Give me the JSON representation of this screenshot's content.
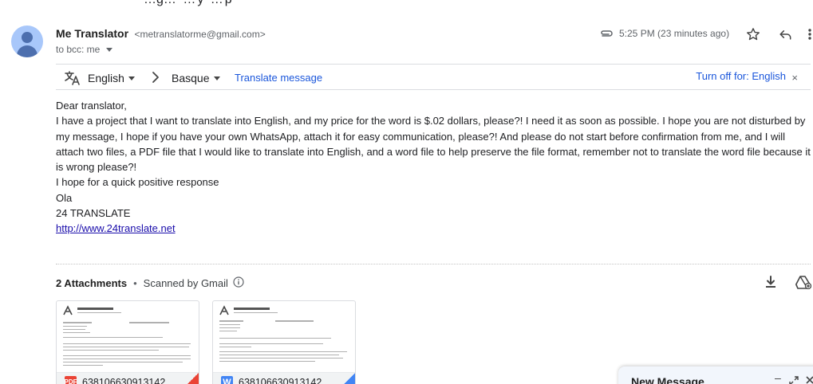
{
  "header_cut": {
    "text": "…g",
    "trail": "…  …y  …p"
  },
  "sender": {
    "name": "Me Translator",
    "email": "<metranslatorme@gmail.com>",
    "to": "to bcc: me"
  },
  "meta": {
    "time": "5:25 PM (23 minutes ago)"
  },
  "translate_bar": {
    "source_lang": "English",
    "target_lang": "Basque",
    "translate_label": "Translate message",
    "turn_off_label": "Turn off for: English",
    "close_label": "×"
  },
  "body": {
    "lines": [
      "Dear translator,",
      "I have a project that I want to translate into English, and my price for the word is $.02 dollars, please?! I need it as soon as possible. I hope you are not disturbed by my message, I hope if you have your own WhatsApp, attach it for easy communication, please?! And please do not start before confirmation from me, and I will attach two files, a PDF file that I would like to translate into English, and a word file to help preserve the file format, remember not to translate the word file because it is wrong please?!",
      "I hope for a quick positive response",
      "Ola",
      "24 TRANSLATE"
    ],
    "link": "http://www.24translate.net"
  },
  "attachments": {
    "title": "2 Attachments",
    "separator": "•",
    "scanned": "Scanned by Gmail",
    "items": [
      {
        "name": "638106630913142",
        "type_badge": "PDF",
        "type": "pdf"
      },
      {
        "name": "638106630913142",
        "type_badge": "W",
        "type": "word"
      }
    ]
  },
  "new_message": {
    "title": "New Message",
    "minimize": "–"
  },
  "icons": {
    "avatar": "person-icon",
    "attachment": "paperclip-icon",
    "star": "star-icon",
    "reply": "reply-icon",
    "more": "more-vert-icon",
    "translate": "translate-icon",
    "arrow": "chevron-right-icon",
    "info": "info-icon",
    "download": "download-icon",
    "drive": "add-to-drive-icon"
  },
  "colors": {
    "link": "#1a56db",
    "pdf": "#ea4335",
    "word": "#4285f4"
  }
}
